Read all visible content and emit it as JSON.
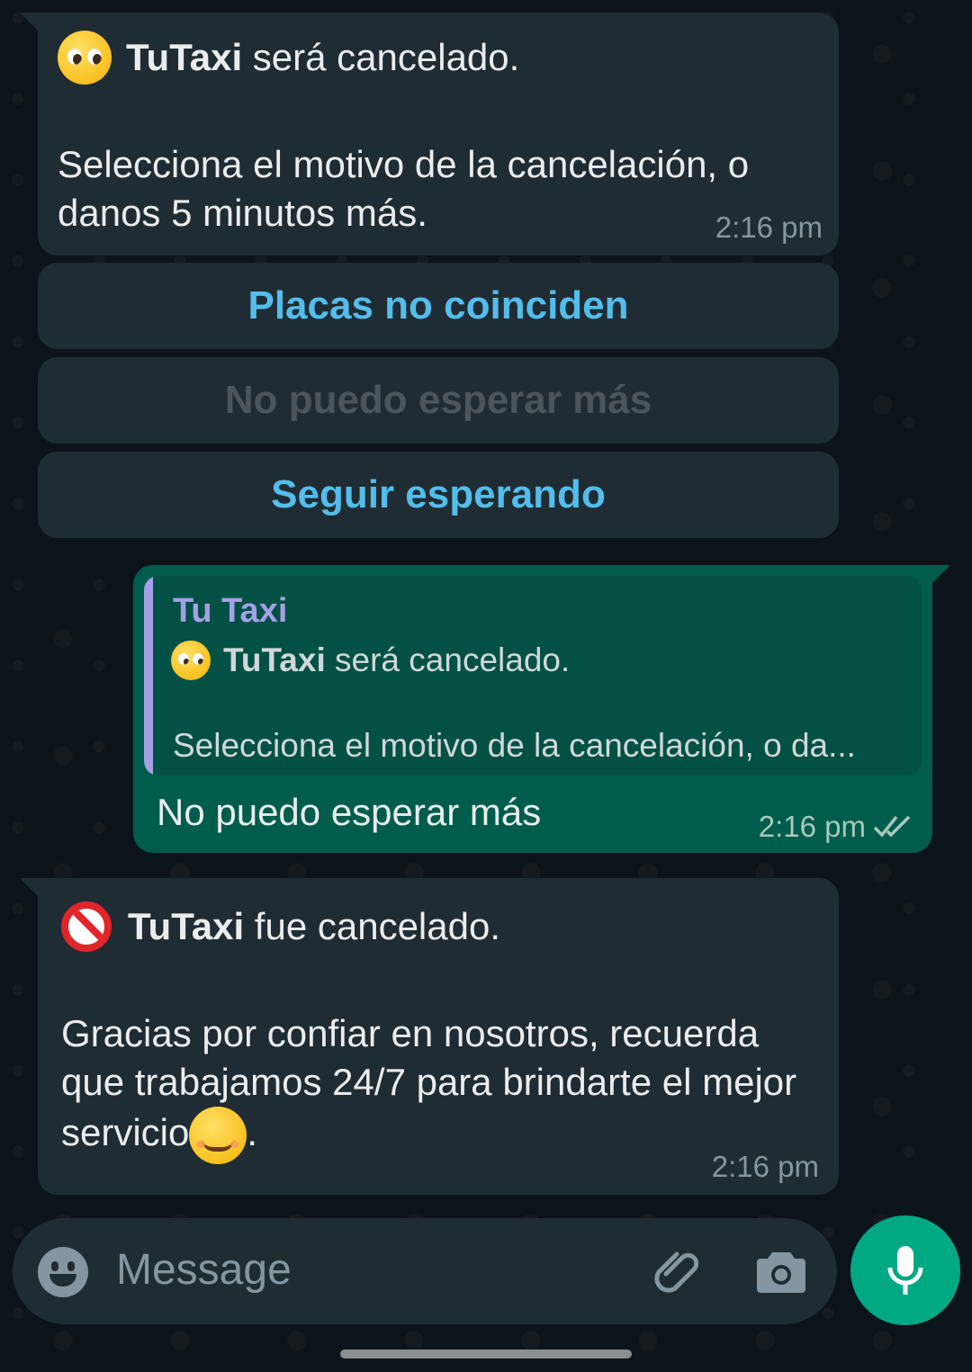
{
  "messages": {
    "m1": {
      "brand": "TuTaxi",
      "title_rest": " será cancelado.",
      "body": "Selecciona el motivo de la cancelación, o danos 5 minutos más.",
      "time": "2:16 pm",
      "emoji": "pleading-face"
    },
    "buttons": [
      {
        "label": "Placas no coinciden",
        "state": "active"
      },
      {
        "label": "No puedo esperar más",
        "state": "disabled"
      },
      {
        "label": "Seguir esperando",
        "state": "active"
      }
    ],
    "reply": {
      "quote_sender": "Tu Taxi",
      "quote_brand": "TuTaxi",
      "quote_title_rest": " será cancelado.",
      "quote_preview": "Selecciona el motivo de la cancelación, o da...",
      "text": "No puedo esperar más",
      "time": "2:16 pm",
      "status": "read-double-check"
    },
    "m2": {
      "brand": "TuTaxi",
      "title_rest": " fue cancelado.",
      "body": "Gracias por confiar en nosotros, recuerda que trabajamos 24/7 para brindarte el mejor servicio",
      "body_end": ".",
      "time": "2:16 pm",
      "emoji": "prohibited",
      "inline_emoji": "smiling-face"
    }
  },
  "composer": {
    "placeholder": "Message",
    "icons": [
      "emoji-icon",
      "attach-icon",
      "camera-icon",
      "mic-icon"
    ]
  },
  "colors": {
    "background": "#0b141a",
    "incoming": "#202c33",
    "outgoing": "#005c4b",
    "button_text": "#53bdeb",
    "mic_button": "#00a884"
  }
}
